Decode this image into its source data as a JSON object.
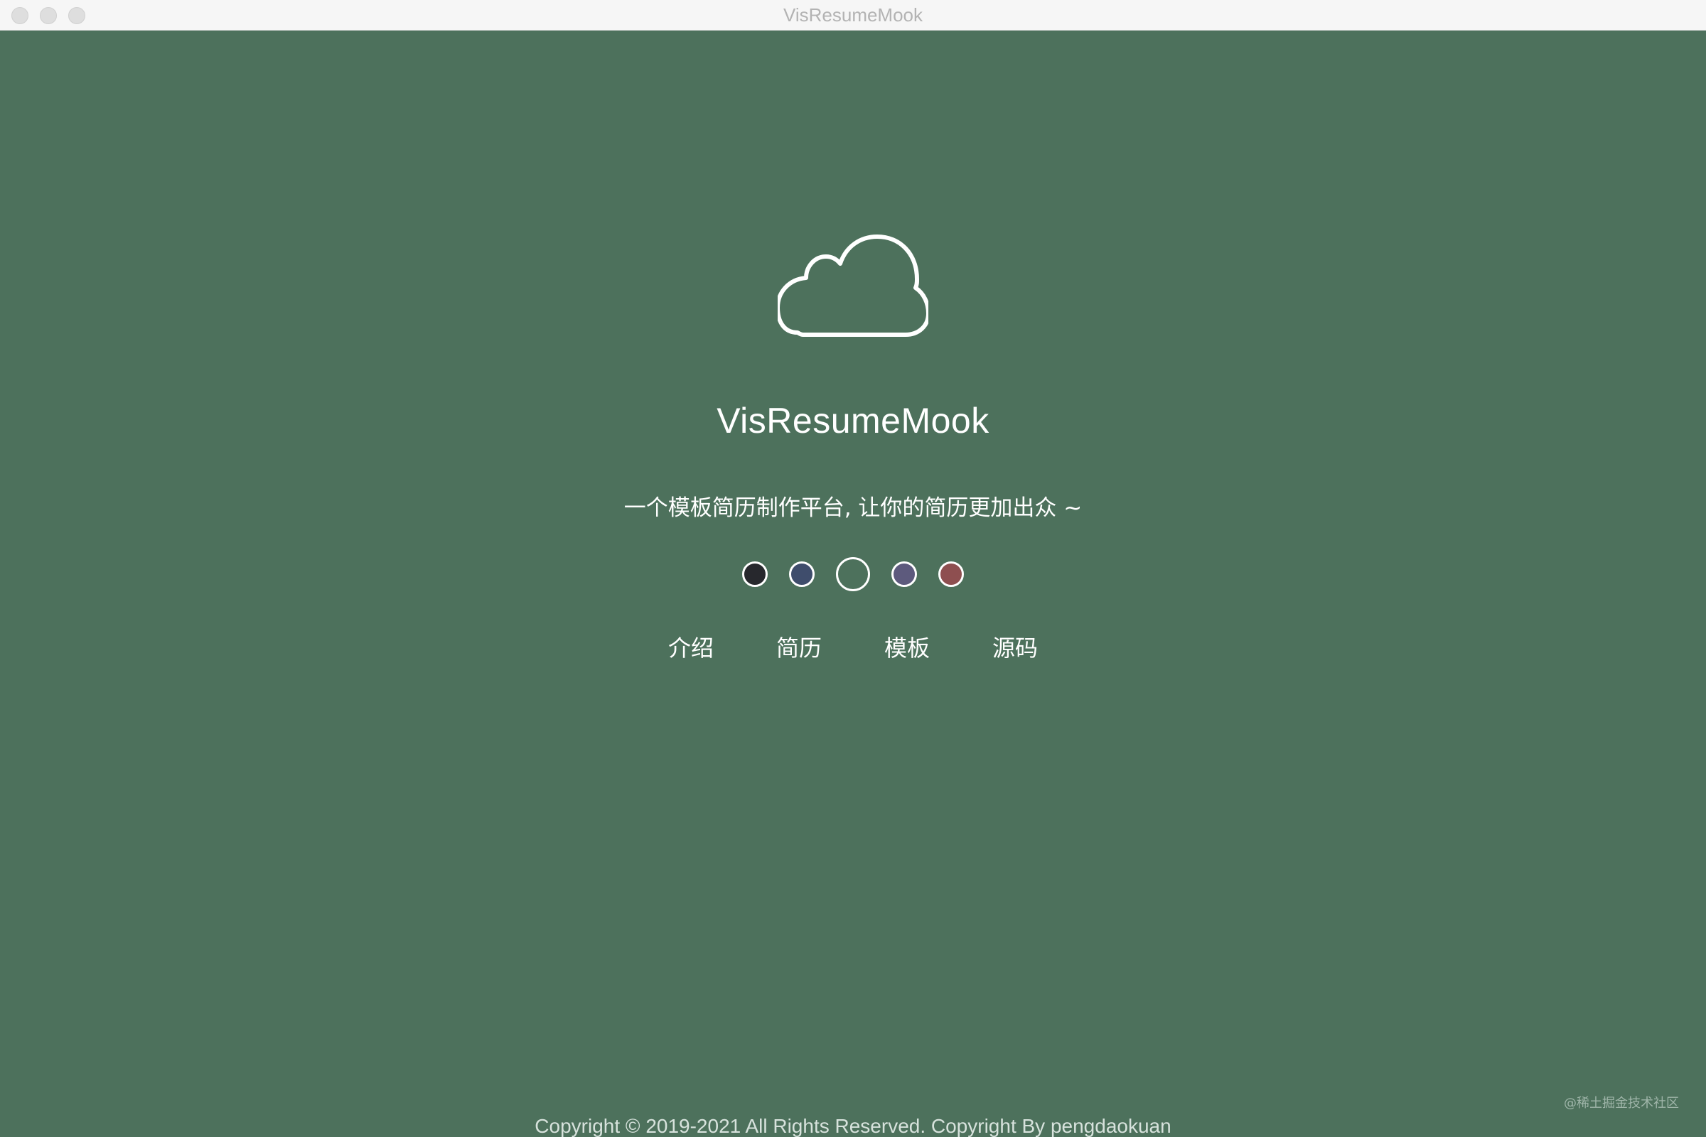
{
  "window": {
    "title": "VisResumeMook"
  },
  "hero": {
    "logo_icon": "cloud-icon",
    "app_name": "VisResumeMook",
    "tagline": "一个模板简历制作平台, 让你的简历更加出众 ~"
  },
  "themes": [
    {
      "name": "dark",
      "color": "#27282d",
      "selected": false
    },
    {
      "name": "navy",
      "color": "#3f4d6c",
      "selected": false
    },
    {
      "name": "green",
      "color": "#4d715c",
      "selected": true
    },
    {
      "name": "purple",
      "color": "#5d5a7d",
      "selected": false
    },
    {
      "name": "red",
      "color": "#8e4f50",
      "selected": false
    }
  ],
  "nav": {
    "intro": "介绍",
    "resume": "简历",
    "template": "模板",
    "source": "源码"
  },
  "footer": {
    "copyright": "Copyright © 2019-2021 All Rights Reserved. Copyright By pengdaokuan"
  },
  "watermark": "@稀土掘金技术社区",
  "colors": {
    "background": "#4d715c",
    "text": "#ffffff"
  }
}
